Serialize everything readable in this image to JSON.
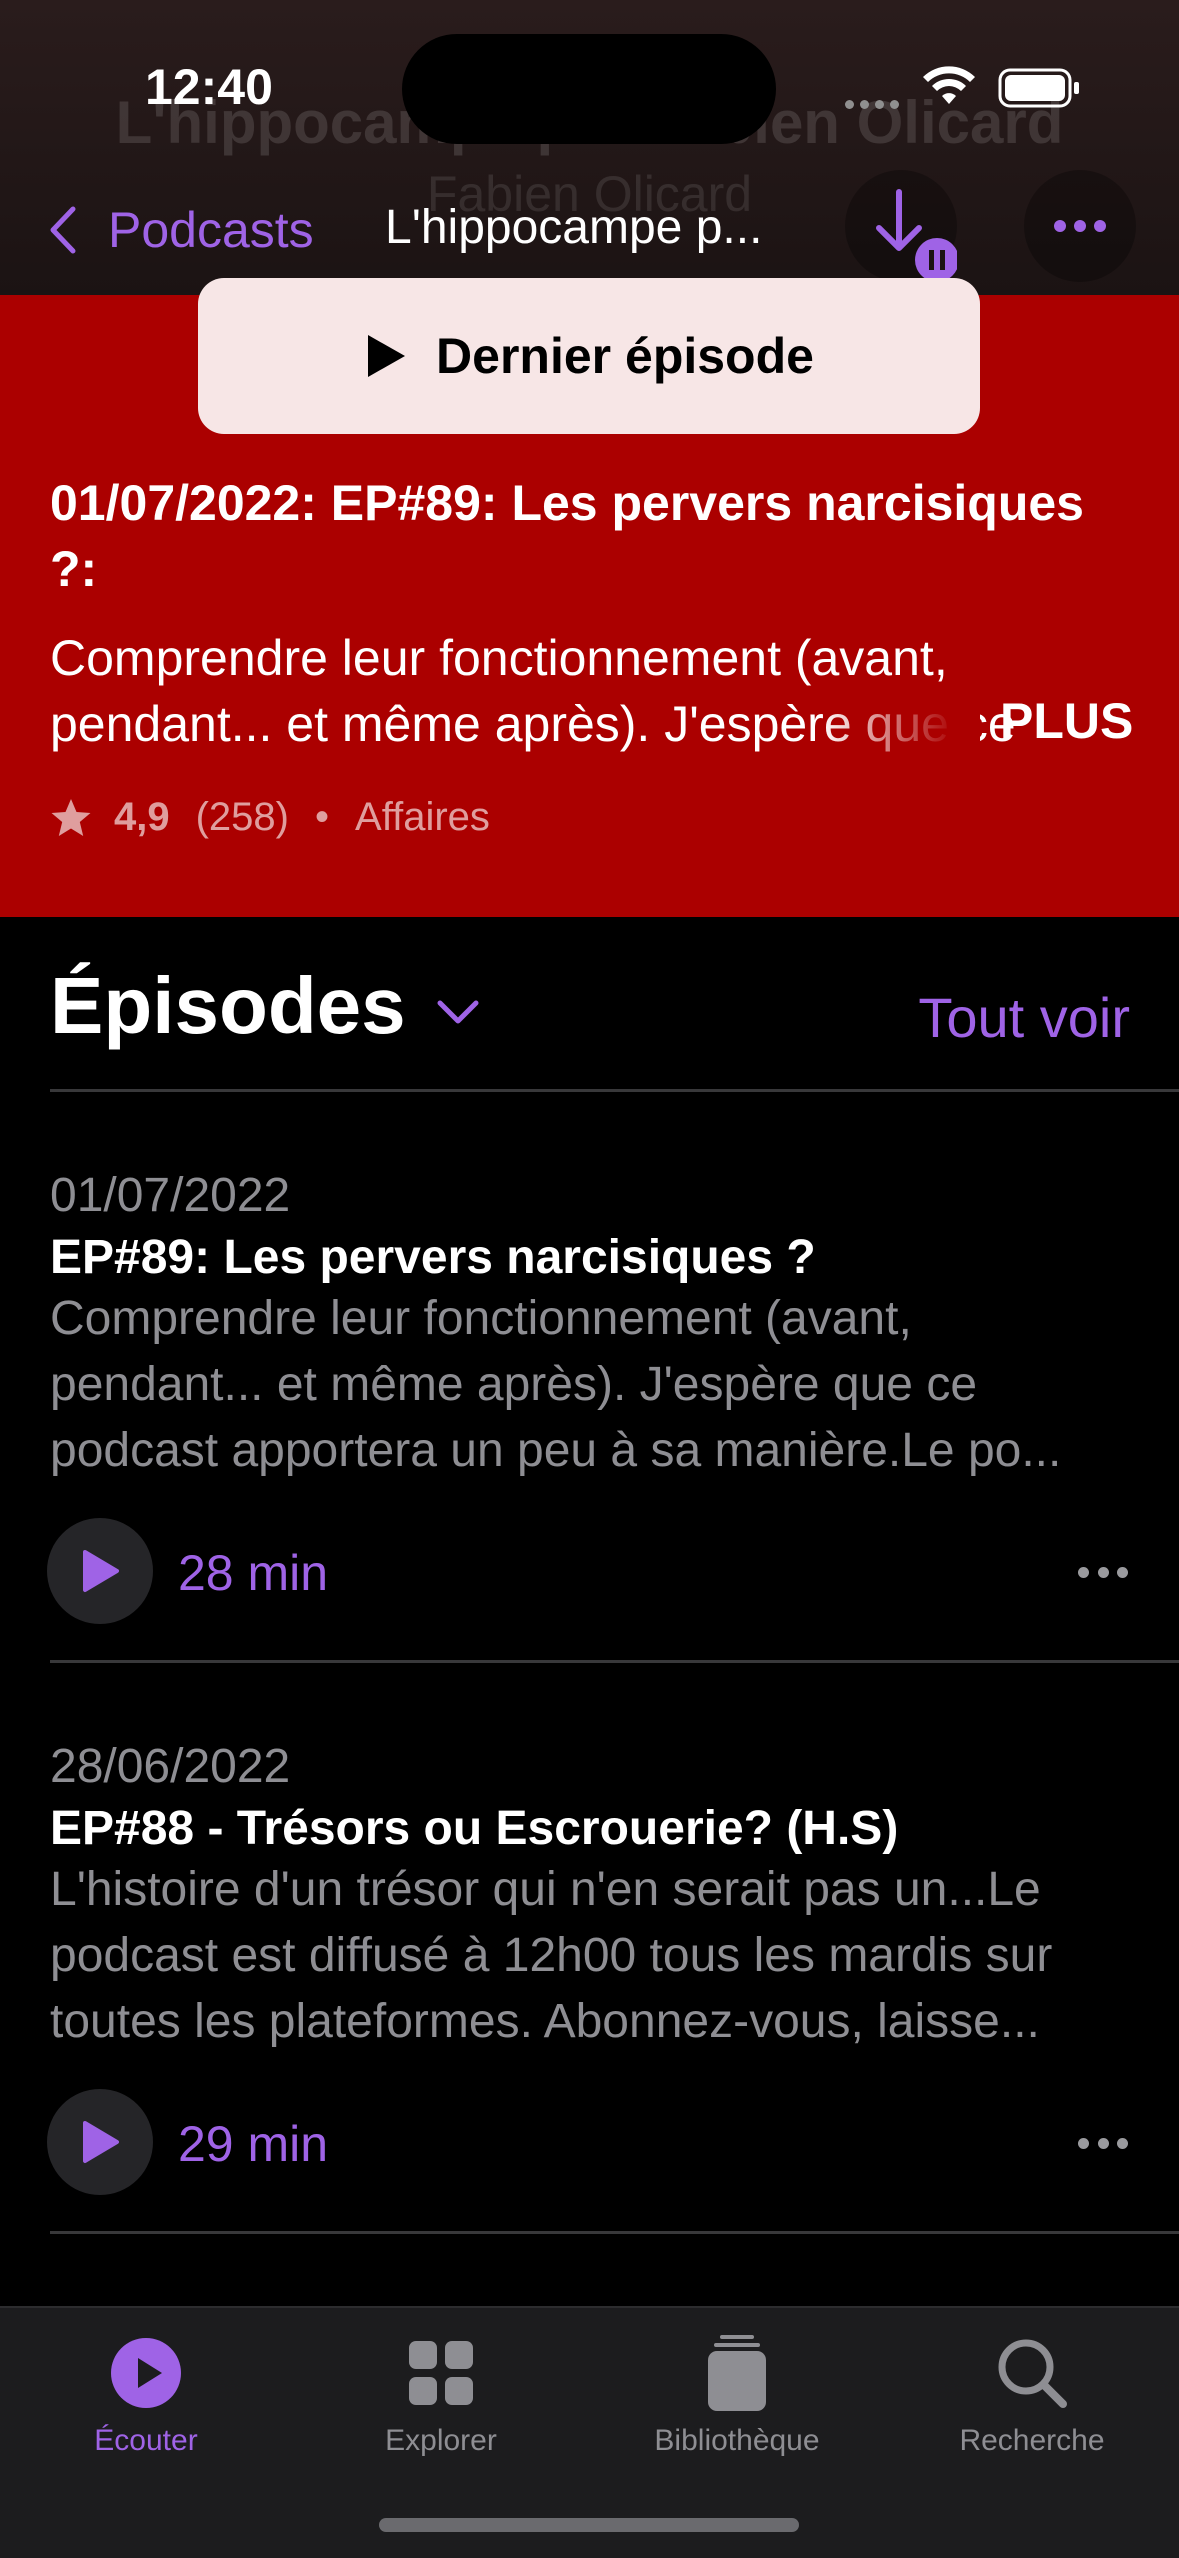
{
  "status_bar": {
    "time": "12:40"
  },
  "header": {
    "ghost_title": "L'hippocampe par Fabien Olicard",
    "ghost_author": "Fabien Olicard",
    "back_label": "Podcasts",
    "nav_title": "L'hippocampe p..."
  },
  "show": {
    "latest_button_label": "Dernier épisode",
    "latest_title": "01/07/2022: EP#89: Les pervers narcisiques ?:",
    "latest_description": "Comprendre leur fonctionnement (avant, pendant... et même après). J'espère que ce podcast apportera un peu à sa manière.",
    "more_label": "PLUS",
    "rating": "4,9",
    "rating_count": "(258)",
    "separator": "•",
    "category": "Affaires"
  },
  "episodes": {
    "title": "Épisodes",
    "see_all": "Tout voir",
    "items": [
      {
        "date": "01/07/2022",
        "title": "EP#89: Les pervers narcisiques ?",
        "description": "Comprendre leur fonctionnement (avant, pendant... et même après). J'espère que ce podcast apportera un peu à sa manière.Le po...",
        "duration": "28 min"
      },
      {
        "date": "28/06/2022",
        "title": "EP#88 - Trésors ou Escrouerie? (H.S)",
        "description": "L'histoire d'un trésor qui n'en serait pas un...Le podcast est diffusé à 12h00 tous les mardis sur toutes les plateformes. Abonnez-vous, laisse...",
        "duration": "29 min"
      }
    ]
  },
  "tabs": [
    {
      "label": "Écouter",
      "icon": "play-circle-icon",
      "active": true
    },
    {
      "label": "Explorer",
      "icon": "grid-icon",
      "active": false
    },
    {
      "label": "Bibliothèque",
      "icon": "library-stack-icon",
      "active": false
    },
    {
      "label": "Recherche",
      "icon": "magnifier-icon",
      "active": false
    }
  ],
  "colors": {
    "accent": "#9f63e6",
    "header_red": "#ab0000",
    "background": "#000000",
    "tab_bar": "#1c1c1e"
  }
}
